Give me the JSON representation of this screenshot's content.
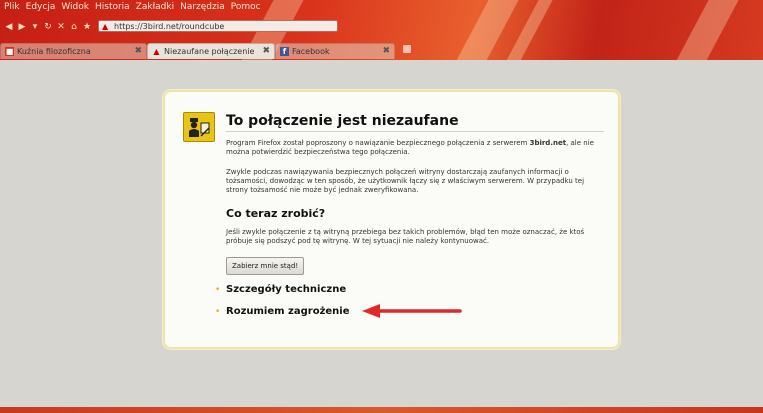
{
  "menubar": {
    "items": [
      "Plik",
      "Edycja",
      "Widok",
      "Historia",
      "Zakładki",
      "Narzędzia",
      "Pomoc"
    ]
  },
  "navbar": {
    "url": "https://3bird.net/roundcube"
  },
  "tabs": [
    {
      "label": "Kuźnia filozoficzna",
      "active": false
    },
    {
      "label": "Niezaufane połączenie",
      "active": true
    },
    {
      "label": "Facebook",
      "active": false
    }
  ],
  "error_page": {
    "title": "To połączenie jest niezaufane",
    "para1_before": "Program Firefox został poproszony o nawiązanie bezpiecznego połączenia z serwerem ",
    "para1_host": "3bird.net",
    "para1_after": ", ale nie można potwierdzić bezpieczeństwa tego połączenia.",
    "para2": "Zwykle podczas nawiązywania bezpiecznych połączeń witryny dostarczają zaufanych informacji o tożsamości, dowodząc w ten sposób, że użytkownik łączy się z właściwym serwerem. W przypadku tej strony tożsamość nie może być jednak zweryfikowana.",
    "subheading": "Co teraz zrobić?",
    "para3": "Jeśli zwykle połączenie z tą witryną przebiega bez takich problemów, błąd ten może oznaczać, że ktoś próbuje się podszyć pod tę witrynę. W tej sytuacji nie należy kontynuować.",
    "escape_button": "Zabierz mnie stąd!",
    "technical_details": "Szczegóły techniczne",
    "understand_risks": "Rozumiem zagrożenie"
  },
  "colors": {
    "annotation_arrow": "#e0282a",
    "expander_bullet": "#f0a623",
    "panel_border": "#efe3ad"
  }
}
